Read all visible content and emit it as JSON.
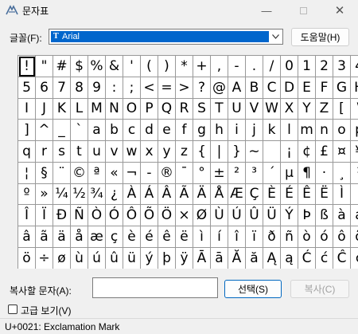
{
  "window": {
    "title": "문자표"
  },
  "font_select": {
    "label": "글꼴(F):",
    "value": "Arial",
    "type_badge": "T"
  },
  "help_button": "도움말(H)",
  "characters": [
    "!",
    "\"",
    "#",
    "$",
    "%",
    "&",
    "'",
    "(",
    ")",
    "*",
    "+",
    ",",
    "-",
    ".",
    "/",
    "0",
    "1",
    "2",
    "3",
    "4",
    "5",
    "6",
    "7",
    "8",
    "9",
    ":",
    ";",
    "<",
    "=",
    ">",
    "?",
    "@",
    "A",
    "B",
    "C",
    "D",
    "E",
    "F",
    "G",
    "H",
    "I",
    "J",
    "K",
    "L",
    "M",
    "N",
    "O",
    "P",
    "Q",
    "R",
    "S",
    "T",
    "U",
    "V",
    "W",
    "X",
    "Y",
    "Z",
    "[",
    "\\",
    "]",
    "^",
    "_",
    "`",
    "a",
    "b",
    "c",
    "d",
    "e",
    "f",
    "g",
    "h",
    "i",
    "j",
    "k",
    "l",
    "m",
    "n",
    "o",
    "p",
    "q",
    "r",
    "s",
    "t",
    "u",
    "v",
    "w",
    "x",
    "y",
    "z",
    "{",
    "|",
    "}",
    "~",
    " ",
    "¡",
    "¢",
    "£",
    "¤",
    "¥",
    "¦",
    "§",
    "¨",
    "©",
    "ª",
    "«",
    "¬",
    "-",
    "®",
    "¯",
    "°",
    "±",
    "²",
    "³",
    "´",
    "µ",
    "¶",
    "·",
    "¸",
    "¹",
    "º",
    "»",
    "¼",
    "½",
    "¾",
    "¿",
    "À",
    "Á",
    "Â",
    "Ã",
    "Ä",
    "Å",
    "Æ",
    "Ç",
    "È",
    "É",
    "Ê",
    "Ë",
    "Ì",
    "Í",
    "Î",
    "Ï",
    "Ð",
    "Ñ",
    "Ò",
    "Ó",
    "Ô",
    "Õ",
    "Ö",
    "×",
    "Ø",
    "Ù",
    "Ú",
    "Û",
    "Ü",
    "Ý",
    "Þ",
    "ß",
    "à",
    "á",
    "â",
    "ã",
    "ä",
    "å",
    "æ",
    "ç",
    "è",
    "é",
    "ê",
    "ë",
    "ì",
    "í",
    "î",
    "ï",
    "ð",
    "ñ",
    "ò",
    "ó",
    "ô",
    "õ",
    "ö",
    "÷",
    "ø",
    "ù",
    "ú",
    "û",
    "ü",
    "ý",
    "þ",
    "ÿ",
    "Ā",
    "ā",
    "Ă",
    "ă",
    "Ą",
    "ą",
    "Ć",
    "ć",
    "Ĉ",
    "ĉ"
  ],
  "selected_index": 0,
  "copy_section": {
    "label": "복사할 문자(A):",
    "value": "",
    "select_button": "선택(S)",
    "copy_button": "복사(C)"
  },
  "advanced_view": {
    "label": "고급 보기(V)",
    "checked": false
  },
  "status": "U+0021: Exclamation Mark"
}
